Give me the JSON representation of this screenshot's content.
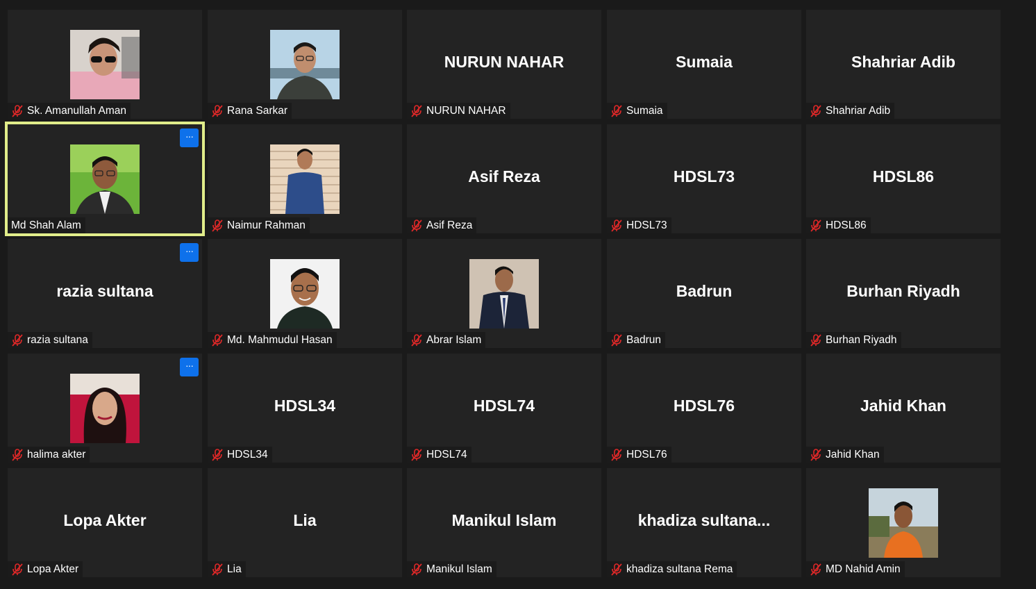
{
  "participants": [
    {
      "name": "Sk. Amanullah Aman",
      "video_label": "",
      "has_photo": true,
      "muted": true
    },
    {
      "name": "Rana Sarkar",
      "video_label": "",
      "has_photo": true,
      "muted": true
    },
    {
      "name": "NURUN NAHAR",
      "video_label": "NURUN NAHAR",
      "has_photo": false,
      "muted": true
    },
    {
      "name": "Sumaia",
      "video_label": "Sumaia",
      "has_photo": false,
      "muted": true
    },
    {
      "name": "Shahriar Adib",
      "video_label": "Shahriar Adib",
      "has_photo": false,
      "muted": true
    },
    {
      "name": "Md Shah Alam",
      "video_label": "",
      "has_photo": true,
      "muted": false,
      "active_speaker": true,
      "show_more": true
    },
    {
      "name": "Naimur Rahman",
      "video_label": "",
      "has_photo": true,
      "muted": true
    },
    {
      "name": "Asif Reza",
      "video_label": "Asif Reza",
      "has_photo": false,
      "muted": true
    },
    {
      "name": "HDSL73",
      "video_label": "HDSL73",
      "has_photo": false,
      "muted": true
    },
    {
      "name": "HDSL86",
      "video_label": "HDSL86",
      "has_photo": false,
      "muted": true
    },
    {
      "name": "razia sultana",
      "video_label": "razia sultana",
      "has_photo": false,
      "muted": true,
      "show_more": true
    },
    {
      "name": "Md. Mahmudul Hasan",
      "video_label": "",
      "has_photo": true,
      "muted": true
    },
    {
      "name": "Abrar Islam",
      "video_label": "",
      "has_photo": true,
      "muted": true
    },
    {
      "name": "Badrun",
      "video_label": "Badrun",
      "has_photo": false,
      "muted": true
    },
    {
      "name": "Burhan Riyadh",
      "video_label": "Burhan Riyadh",
      "has_photo": false,
      "muted": true
    },
    {
      "name": "halima akter",
      "video_label": "",
      "has_photo": true,
      "muted": true,
      "show_more": true
    },
    {
      "name": "HDSL34",
      "video_label": "HDSL34",
      "has_photo": false,
      "muted": true
    },
    {
      "name": "HDSL74",
      "video_label": "HDSL74",
      "has_photo": false,
      "muted": true
    },
    {
      "name": "HDSL76",
      "video_label": "HDSL76",
      "has_photo": false,
      "muted": true
    },
    {
      "name": "Jahid Khan",
      "video_label": "Jahid Khan",
      "has_photo": false,
      "muted": true
    },
    {
      "name": "Lopa Akter",
      "video_label": "Lopa Akter",
      "has_photo": false,
      "muted": true
    },
    {
      "name": "Lia",
      "video_label": "Lia",
      "has_photo": false,
      "muted": true
    },
    {
      "name": "Manikul Islam",
      "video_label": "Manikul Islam",
      "has_photo": false,
      "muted": true
    },
    {
      "name": "khadiza sultana Rema",
      "video_label": "khadiza  sultana...",
      "has_photo": false,
      "muted": true
    },
    {
      "name": "MD Nahid Amin",
      "video_label": "",
      "has_photo": true,
      "muted": true
    }
  ],
  "more_button_label": "···",
  "icons": {
    "mic_muted": "microphone-muted-icon",
    "more": "more-options-icon"
  },
  "colors": {
    "active_speaker_border": "#e1ed8a",
    "more_button": "#0e71eb",
    "muted_icon": "#e02828",
    "tile_bg": "#232323"
  }
}
